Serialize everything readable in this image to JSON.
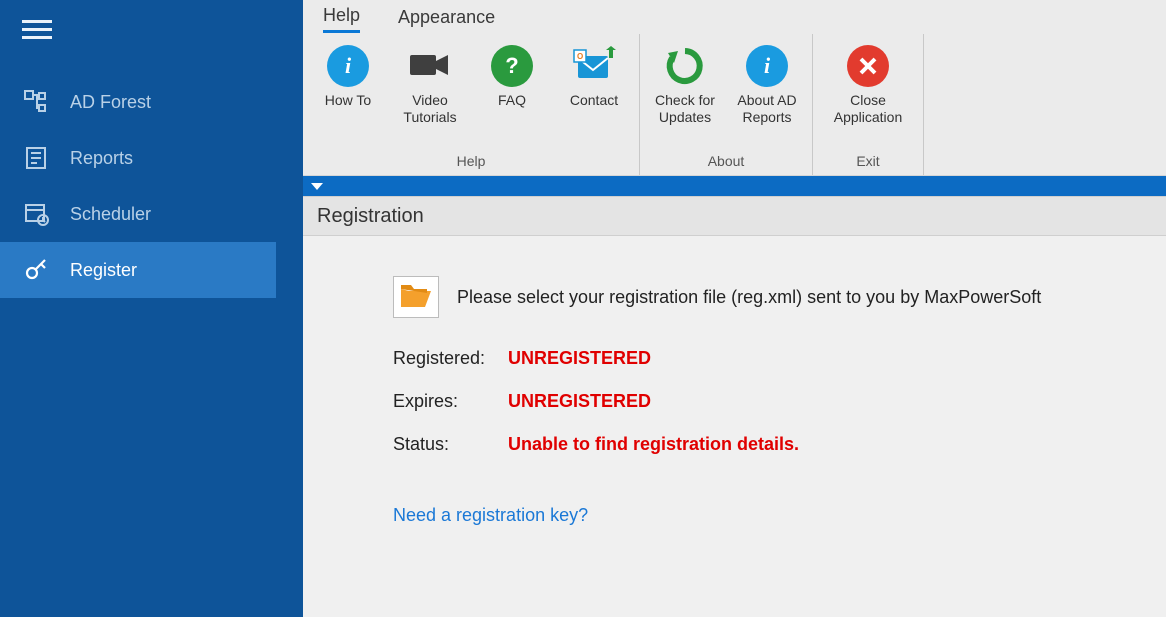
{
  "sidebar": {
    "items": [
      {
        "label": "AD Forest"
      },
      {
        "label": "Reports"
      },
      {
        "label": "Scheduler"
      },
      {
        "label": "Register"
      }
    ]
  },
  "tabs": {
    "help": "Help",
    "appearance": "Appearance"
  },
  "ribbon": {
    "help": {
      "howto": "How To",
      "video": "Video Tutorials",
      "faq": "FAQ",
      "contact": "Contact",
      "group": "Help"
    },
    "about": {
      "check": "Check for Updates",
      "aboutad": "About AD Reports",
      "group": "About"
    },
    "exit": {
      "close": "Close Application",
      "group": "Exit"
    }
  },
  "panel": {
    "title": "Registration",
    "instruction": "Please select your registration file (reg.xml) sent to you by MaxPowerSoft",
    "registered_label": "Registered:",
    "registered_value": "UNREGISTERED",
    "expires_label": "Expires:",
    "expires_value": "UNREGISTERED",
    "status_label": "Status:",
    "status_value": "Unable to find registration details.",
    "link": "Need a registration key?"
  }
}
